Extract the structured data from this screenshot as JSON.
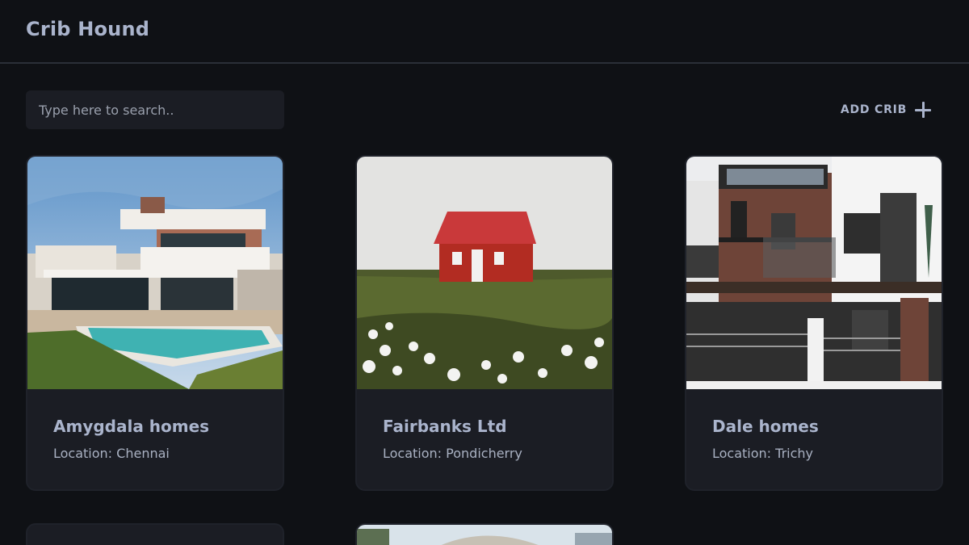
{
  "app": {
    "title": "Crib Hound"
  },
  "search": {
    "placeholder": "Type here to search..",
    "value": ""
  },
  "toolbar": {
    "add_label": "ADD CRIB",
    "add_icon": "plus-icon"
  },
  "location_prefix": "Location:",
  "cribs": [
    {
      "name": "Amygdala homes",
      "location": "Chennai"
    },
    {
      "name": "Fairbanks Ltd",
      "location": "Pondicherry"
    },
    {
      "name": "Dale homes",
      "location": "Trichy"
    },
    {
      "name": "",
      "location": ""
    },
    {
      "name": "",
      "location": ""
    }
  ],
  "colors": {
    "background": "#0f1115",
    "card": "#1b1d24",
    "text": "#aab4cc",
    "divider": "#2b2f38"
  }
}
